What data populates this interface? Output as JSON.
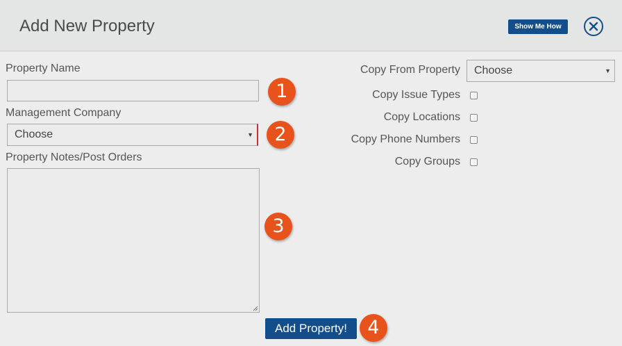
{
  "header": {
    "title": "Add New Property",
    "show_me_how": "Show Me How",
    "close_icon": "circle-x-icon"
  },
  "form": {
    "property_name": {
      "label": "Property Name",
      "value": ""
    },
    "management_company": {
      "label": "Management Company",
      "value": "Choose"
    },
    "notes": {
      "label": "Property Notes/Post Orders",
      "value": ""
    },
    "copy_from": {
      "label": "Copy From Property",
      "value": "Choose"
    },
    "copy_options": [
      {
        "label": "Copy Issue Types",
        "checked": false
      },
      {
        "label": "Copy Locations",
        "checked": false
      },
      {
        "label": "Copy Phone Numbers",
        "checked": false
      },
      {
        "label": "Copy Groups",
        "checked": false
      }
    ],
    "submit_label": "Add Property!"
  },
  "step_badges": [
    "1",
    "2",
    "3",
    "4"
  ],
  "colors": {
    "primary": "#134e8a",
    "badge": "#e8531c",
    "background": "#ededed",
    "header": "#e4e5e5"
  }
}
